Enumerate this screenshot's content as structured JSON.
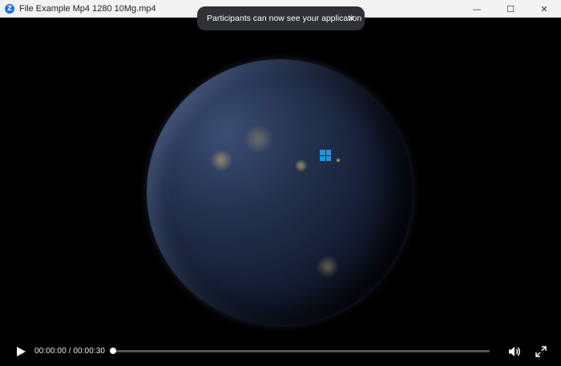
{
  "window": {
    "app_icon_letter": "Z",
    "title": "File Example Mp4 1280 10Mg.mp4",
    "controls": {
      "minimize": "—",
      "maximize": "☐",
      "close": "✕"
    }
  },
  "notification": {
    "message": "Participants can now see your application",
    "close_glyph": "×"
  },
  "player": {
    "time_display": "00:00:00 / 00:00:30",
    "progress_fraction": 0,
    "play_icon": "play-icon",
    "volume_icon": "volume-icon",
    "fullscreen_icon": "fullscreen-icon"
  },
  "colors": {
    "accent": "#1a73e8",
    "windows_logo": "#2a8fe0",
    "toast_bg": "#2f3135"
  }
}
